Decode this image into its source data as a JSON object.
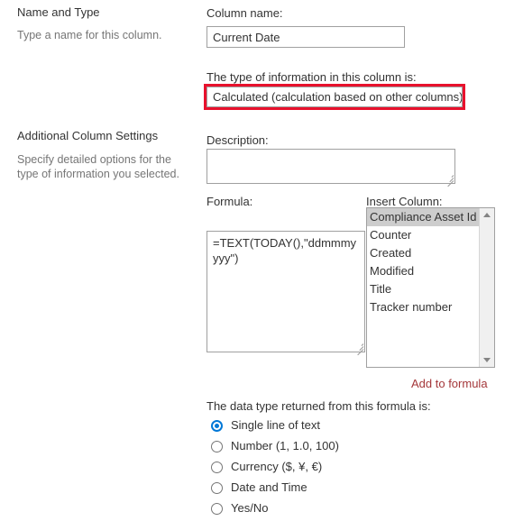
{
  "sections": {
    "name_and_type": {
      "heading": "Name and Type",
      "help": "Type a name for this column."
    },
    "additional_settings": {
      "heading": "Additional Column Settings",
      "help": "Specify detailed options for the type of information you selected."
    }
  },
  "form": {
    "column_name": {
      "label": "Column name:",
      "value": "Current Date",
      "placeholder": ""
    },
    "type_of_information": {
      "label": "The type of information in this column is:",
      "selected": "Calculated (calculation based on other columns)",
      "highlighted": true
    },
    "description": {
      "label": "Description:",
      "value": "",
      "placeholder": ""
    },
    "formula": {
      "label": "Formula:",
      "value": "=TEXT(TODAY(),\"ddmmmyyyy\")",
      "placeholder": ""
    },
    "insert_column": {
      "label": "Insert Column:",
      "items": [
        "Compliance Asset Id",
        "Counter",
        "Created",
        "Modified",
        "Title",
        "Tracker number"
      ],
      "selected_index": 0,
      "scroll_up_icon": "triangle-up-icon",
      "scroll_down_icon": "triangle-down-icon"
    },
    "add_to_formula": {
      "label": "Add to formula"
    },
    "data_type": {
      "label": "The data type returned from this formula is:",
      "options": [
        "Single line of text",
        "Number (1, 1.0, 100)",
        "Currency ($, ¥, €)",
        "Date and Time",
        "Yes/No"
      ],
      "selected_index": 0
    }
  },
  "colors": {
    "annotation_red": "#e8112d",
    "accent_blue": "#0078d7",
    "link_red": "#a4373a",
    "selection_gray": "#cdcdcd",
    "heading_text": "#333333",
    "help_text": "#767676"
  }
}
